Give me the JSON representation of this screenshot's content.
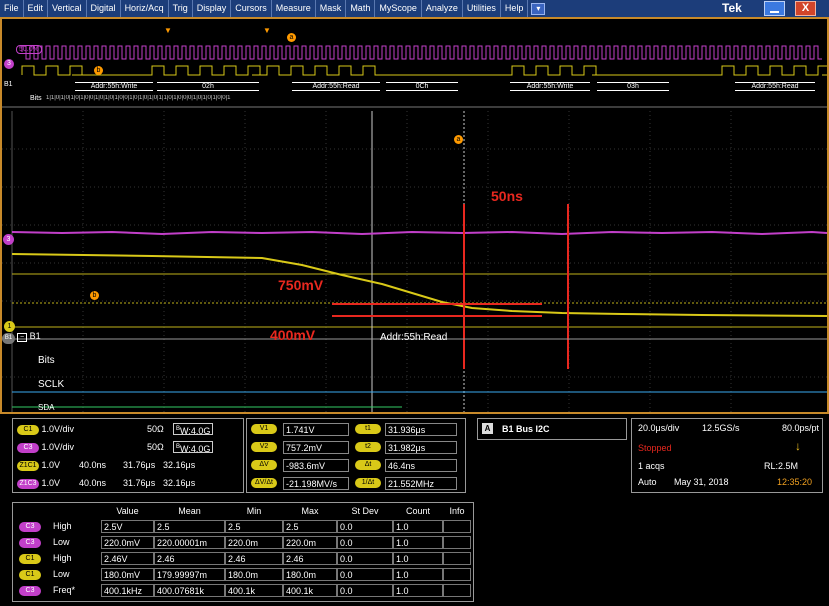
{
  "menubar": {
    "items": [
      "File",
      "Edit",
      "Vertical",
      "Digital",
      "Horiz/Acq",
      "Trig",
      "Display",
      "Cursors",
      "Measure",
      "Mask",
      "Math",
      "MyScope",
      "Analyze",
      "Utilities",
      "Help"
    ],
    "brand": "Tek"
  },
  "overview": {
    "percent_label": "50.0%",
    "bus_name": "B1",
    "bits_label": "Bits",
    "packets": [
      "Addr:55h:Write",
      "02h",
      "Addr:55h:Read",
      "0Ch",
      "Addr:55h:Write",
      "03h",
      "Addr:55h:Read"
    ],
    "bits_text": "1|1|0|1|0|1|0|1|0|0|1|0|1|0|1|0|0|1|0|1|0|1|0|1|1|0|1|0|0|0|1|0|1|0|1|0|0|1",
    "cursor_a_label": "a",
    "cursor_b_label": "b"
  },
  "main": {
    "cursor_a_label": "a",
    "cursor_b_label": "b",
    "ch3_marker": "3",
    "ch1_marker": "1",
    "bus_marker": "B1",
    "bus_name": "B1",
    "annotation_50ns": "50ns",
    "annotation_750mv": "750mV",
    "annotation_400mv": "400mV",
    "decode_text": "Addr:55h:Read",
    "bits_label": "Bits",
    "sclk_label": "SCLK",
    "sda_label": "SDA"
  },
  "channels": [
    {
      "id": "C1",
      "scale": "1.0V/div",
      "imp": "50Ω",
      "bw_sup": "B",
      "bw": "W:4.0G",
      "color": "#d9c918"
    },
    {
      "id": "C3",
      "scale": "1.0V/div",
      "imp": "50Ω",
      "bw_sup": "B",
      "bw": "W:4.0G",
      "color": "#c23fc9"
    },
    {
      "id": "Z1C1",
      "scale": "1.0V",
      "t1": "40.0ns",
      "t2": "31.76μs",
      "t3": "32.16μs",
      "color": "#d9c918"
    },
    {
      "id": "Z1C3",
      "scale": "1.0V",
      "t1": "40.0ns",
      "t2": "31.76μs",
      "t3": "32.16μs",
      "color": "#c23fc9"
    }
  ],
  "cursors": {
    "left": [
      {
        "label": "V1",
        "value": "1.741V"
      },
      {
        "label": "V2",
        "value": "757.2mV"
      },
      {
        "label": "ΔV",
        "value": "-983.6mV"
      },
      {
        "label": "ΔV/Δt",
        "value": "-21.198MV/s"
      }
    ],
    "right": [
      {
        "label": "t1",
        "value": "31.936μs"
      },
      {
        "label": "t2",
        "value": "31.982μs"
      },
      {
        "label": "Δt",
        "value": "46.4ns"
      },
      {
        "label": "1/Δt",
        "value": "21.552MHz"
      }
    ]
  },
  "bus": {
    "badge": "A",
    "label": "B1 Bus I2C"
  },
  "acquisition": {
    "timebase": "20.0μs/div",
    "sample_rate": "12.5GS/s",
    "resolution": "80.0ps/pt",
    "state": "Stopped",
    "acqs": "1 acqs",
    "record_length": "RL:2.5M",
    "mode": "Auto",
    "date": "May 31, 2018",
    "time": "12:35:20"
  },
  "measurements": {
    "headers": [
      "Value",
      "Mean",
      "Min",
      "Max",
      "St Dev",
      "Count",
      "Info"
    ],
    "rows": [
      {
        "ch": "C3",
        "name": "High",
        "cells": [
          "2.5V",
          "2.5",
          "2.5",
          "2.5",
          "0.0",
          "1.0",
          ""
        ],
        "color": "#c23fc9"
      },
      {
        "ch": "C3",
        "name": "Low",
        "cells": [
          "220.0mV",
          "220.00001m",
          "220.0m",
          "220.0m",
          "0.0",
          "1.0",
          ""
        ],
        "color": "#c23fc9"
      },
      {
        "ch": "C1",
        "name": "High",
        "cells": [
          "2.46V",
          "2.46",
          "2.46",
          "2.46",
          "0.0",
          "1.0",
          ""
        ],
        "color": "#d9c918"
      },
      {
        "ch": "C1",
        "name": "Low",
        "cells": [
          "180.0mV",
          "179.99997m",
          "180.0m",
          "180.0m",
          "0.0",
          "1.0",
          ""
        ],
        "color": "#d9c918"
      },
      {
        "ch": "C3",
        "name": "Freq*",
        "cells": [
          "400.1kHz",
          "400.07681k",
          "400.1k",
          "400.1k",
          "0.0",
          "1.0",
          ""
        ],
        "color": "#c23fc9"
      }
    ]
  }
}
